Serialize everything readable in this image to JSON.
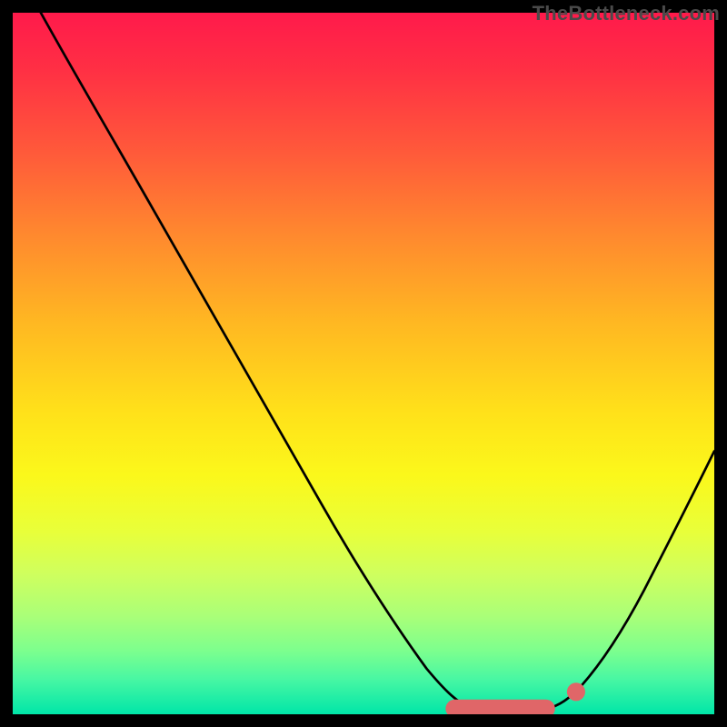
{
  "watermark": "TheBottleneck.com",
  "colors": {
    "frame": "#000000",
    "curve_stroke": "#000000",
    "marker_fill": "#e06668",
    "gradient_top": "#ff1a4b",
    "gradient_bottom": "#00e6a8"
  },
  "chart_data": {
    "type": "line",
    "title": "",
    "xlabel": "",
    "ylabel": "",
    "xlim": [
      0,
      100
    ],
    "ylim": [
      0,
      100
    ],
    "grid": false,
    "legend": false,
    "annotations": [],
    "series": [
      {
        "name": "bottleneck-curve",
        "x": [
          4,
          10,
          20,
          30,
          40,
          50,
          57,
          60,
          63,
          66,
          69,
          72,
          75,
          78,
          80,
          84,
          88,
          92,
          96,
          100
        ],
        "values": [
          100,
          89,
          72,
          55,
          38,
          21,
          10,
          6,
          3,
          1,
          0,
          0,
          0,
          1,
          2,
          5,
          10,
          17,
          26,
          37
        ]
      }
    ],
    "markers": [
      {
        "name": "optimal-start-cap",
        "x": 63,
        "y": 1.5,
        "r": 1.3
      },
      {
        "name": "optimal-segment",
        "x_from": 63,
        "x_to": 76,
        "y": 0.5,
        "thickness": 2.6
      },
      {
        "name": "optimal-right-dot",
        "x": 80,
        "y": 2.5,
        "r": 1.3
      }
    ]
  }
}
